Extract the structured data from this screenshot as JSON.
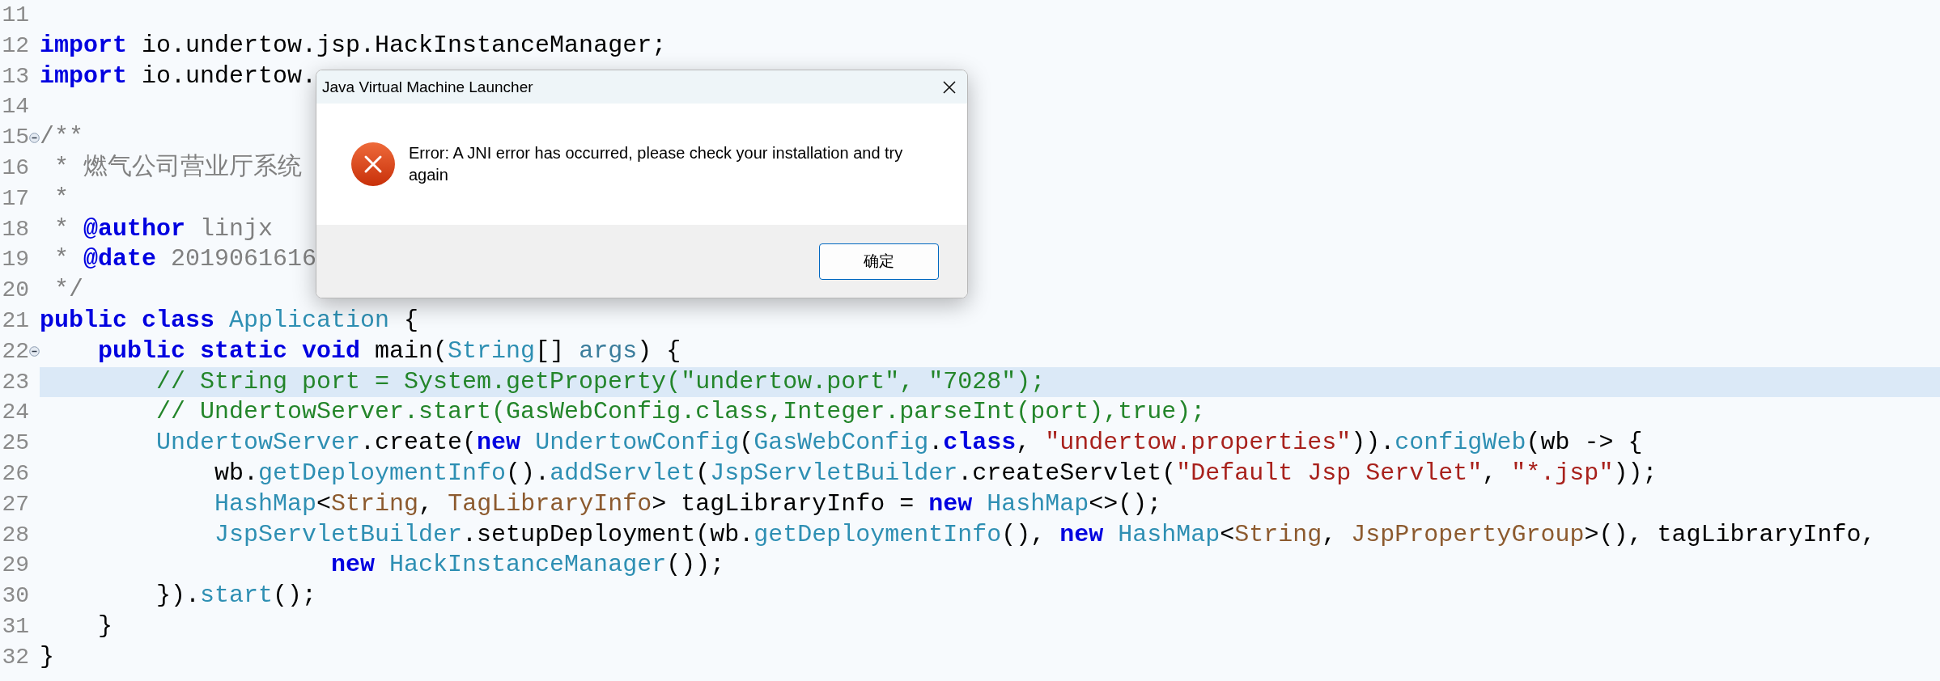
{
  "editor": {
    "lines": [
      {
        "number": "11",
        "fold": false,
        "current": false
      },
      {
        "number": "12",
        "fold": false,
        "current": false,
        "tokens": [
          {
            "kind": "keyword",
            "text": "import"
          },
          {
            "kind": "plain",
            "text": " io.undertow.jsp.HackInstanceManager;"
          }
        ]
      },
      {
        "number": "13",
        "fold": false,
        "current": false,
        "tokens": [
          {
            "kind": "keyword",
            "text": "import"
          },
          {
            "kind": "plain",
            "text": " io.undertow."
          }
        ]
      },
      {
        "number": "14",
        "fold": false,
        "current": false
      },
      {
        "number": "15",
        "fold": true,
        "current": false,
        "tokens": [
          {
            "kind": "doc",
            "text": "/**"
          }
        ]
      },
      {
        "number": "16",
        "fold": false,
        "current": false,
        "tokens": [
          {
            "kind": "doc",
            "text": " * 燃气公司营业厅系统"
          }
        ]
      },
      {
        "number": "17",
        "fold": false,
        "current": false,
        "tokens": [
          {
            "kind": "doc",
            "text": " *"
          }
        ]
      },
      {
        "number": "18",
        "fold": false,
        "current": false,
        "tokens": [
          {
            "kind": "doc",
            "text": " * "
          },
          {
            "kind": "doctag",
            "text": "@author"
          },
          {
            "kind": "doc",
            "text": " linjx"
          }
        ]
      },
      {
        "number": "19",
        "fold": false,
        "current": false,
        "tokens": [
          {
            "kind": "doc",
            "text": " * "
          },
          {
            "kind": "doctag",
            "text": "@date"
          },
          {
            "kind": "doc",
            "text": " 2019061616"
          }
        ]
      },
      {
        "number": "20",
        "fold": false,
        "current": false,
        "tokens": [
          {
            "kind": "doc",
            "text": " */"
          }
        ]
      },
      {
        "number": "21",
        "fold": false,
        "current": false,
        "tokens": [
          {
            "kind": "keyword",
            "text": "public class"
          },
          {
            "kind": "type",
            "text": " Application"
          },
          {
            "kind": "plain",
            "text": " {"
          }
        ]
      },
      {
        "number": "22",
        "fold": true,
        "current": false,
        "tokens": [
          {
            "kind": "keyword",
            "text": "    public static void"
          },
          {
            "kind": "plain",
            "text": " main("
          },
          {
            "kind": "type",
            "text": "String"
          },
          {
            "kind": "plain",
            "text": "[] "
          },
          {
            "kind": "param",
            "text": "args"
          },
          {
            "kind": "plain",
            "text": ") {"
          }
        ]
      },
      {
        "number": "23",
        "fold": false,
        "current": true,
        "tokens": [
          {
            "kind": "comment",
            "text": "        // String port = System.getProperty(\"undertow.port\", \"7028\");"
          }
        ]
      },
      {
        "number": "24",
        "fold": false,
        "current": false,
        "tokens": [
          {
            "kind": "comment",
            "text": "        // UndertowServer.start(GasWebConfig.class,Integer.parseInt(port),true);"
          }
        ]
      },
      {
        "number": "25",
        "fold": false,
        "current": false,
        "tokens": [
          {
            "kind": "type",
            "text": "        UndertowServer"
          },
          {
            "kind": "plain",
            "text": ".create("
          },
          {
            "kind": "keyword",
            "text": "new"
          },
          {
            "kind": "type",
            "text": " UndertowConfig"
          },
          {
            "kind": "plain",
            "text": "("
          },
          {
            "kind": "type",
            "text": "GasWebConfig"
          },
          {
            "kind": "plain",
            "text": "."
          },
          {
            "kind": "keyword",
            "text": "class"
          },
          {
            "kind": "plain",
            "text": ", "
          },
          {
            "kind": "string",
            "text": "\"undertow.properties\""
          },
          {
            "kind": "plain",
            "text": "))."
          },
          {
            "kind": "method",
            "text": "configWeb"
          },
          {
            "kind": "plain",
            "text": "(wb -> {"
          }
        ]
      },
      {
        "number": "26",
        "fold": false,
        "current": false,
        "tokens": [
          {
            "kind": "plain",
            "text": "            wb."
          },
          {
            "kind": "method",
            "text": "getDeploymentInfo"
          },
          {
            "kind": "plain",
            "text": "()."
          },
          {
            "kind": "method",
            "text": "addServlet"
          },
          {
            "kind": "plain",
            "text": "("
          },
          {
            "kind": "type",
            "text": "JspServletBuilder"
          },
          {
            "kind": "plain",
            "text": ".createServlet("
          },
          {
            "kind": "string",
            "text": "\"Default Jsp Servlet\""
          },
          {
            "kind": "plain",
            "text": ", "
          },
          {
            "kind": "string",
            "text": "\"*.jsp\""
          },
          {
            "kind": "plain",
            "text": "));"
          }
        ]
      },
      {
        "number": "27",
        "fold": false,
        "current": false,
        "tokens": [
          {
            "kind": "type",
            "text": "            HashMap"
          },
          {
            "kind": "plain",
            "text": "<"
          },
          {
            "kind": "generic",
            "text": "String"
          },
          {
            "kind": "plain",
            "text": ", "
          },
          {
            "kind": "generic",
            "text": "TagLibraryInfo"
          },
          {
            "kind": "plain",
            "text": "> tagLibraryInfo = "
          },
          {
            "kind": "keyword",
            "text": "new"
          },
          {
            "kind": "type",
            "text": " HashMap"
          },
          {
            "kind": "plain",
            "text": "<>();"
          }
        ]
      },
      {
        "number": "28",
        "fold": false,
        "current": false,
        "tokens": [
          {
            "kind": "type",
            "text": "            JspServletBuilder"
          },
          {
            "kind": "plain",
            "text": ".setupDeployment(wb."
          },
          {
            "kind": "method",
            "text": "getDeploymentInfo"
          },
          {
            "kind": "plain",
            "text": "(), "
          },
          {
            "kind": "keyword",
            "text": "new"
          },
          {
            "kind": "type",
            "text": " HashMap"
          },
          {
            "kind": "plain",
            "text": "<"
          },
          {
            "kind": "generic",
            "text": "String"
          },
          {
            "kind": "plain",
            "text": ", "
          },
          {
            "kind": "generic",
            "text": "JspPropertyGroup"
          },
          {
            "kind": "plain",
            "text": ">(), tagLibraryInfo,"
          }
        ]
      },
      {
        "number": "29",
        "fold": false,
        "current": false,
        "tokens": [
          {
            "kind": "keyword",
            "text": "                    new"
          },
          {
            "kind": "type",
            "text": " HackInstanceManager"
          },
          {
            "kind": "plain",
            "text": "());"
          }
        ]
      },
      {
        "number": "30",
        "fold": false,
        "current": false,
        "tokens": [
          {
            "kind": "plain",
            "text": "        })."
          },
          {
            "kind": "method",
            "text": "start"
          },
          {
            "kind": "plain",
            "text": "();"
          }
        ]
      },
      {
        "number": "31",
        "fold": false,
        "current": false,
        "tokens": [
          {
            "kind": "plain",
            "text": "    }"
          }
        ]
      },
      {
        "number": "32",
        "fold": false,
        "current": false,
        "tokens": [
          {
            "kind": "plain",
            "text": "}"
          }
        ]
      }
    ]
  },
  "dialog": {
    "title": "Java Virtual Machine Launcher",
    "message": "Error: A JNI error has occurred, please check your installation and try again",
    "buttons": [
      "确定"
    ]
  }
}
